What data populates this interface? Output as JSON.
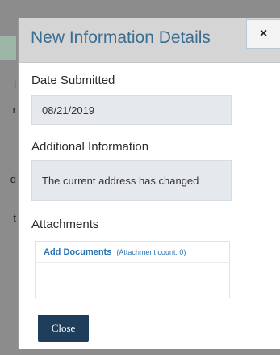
{
  "background": {
    "fragments": [
      "i",
      "r",
      "d",
      "t"
    ]
  },
  "modal": {
    "title": "New Information Details",
    "close_icon": "×",
    "fields": [
      {
        "label": "Date Submitted",
        "value": "08/21/2019"
      },
      {
        "label": "Additional Information",
        "value": "The current address has changed"
      }
    ],
    "attachments": {
      "label": "Attachments",
      "add_documents_label": "Add Documents",
      "count_text": "(Attachment count: 0)"
    },
    "footer": {
      "close_label": "Close"
    }
  },
  "colors": {
    "title": "#3a6e92",
    "link": "#2a73b5",
    "primary_button": "#1f3e5c",
    "field_bg": "#e5e9ed",
    "header_bg": "#d5d5d5"
  }
}
